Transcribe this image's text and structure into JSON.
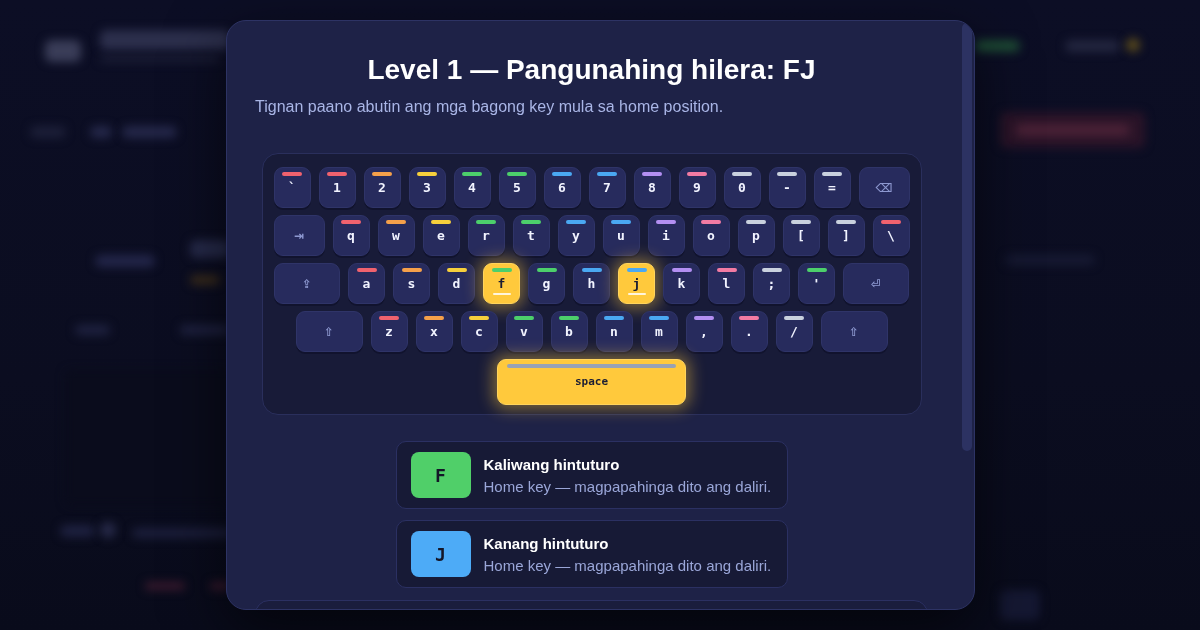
{
  "modal": {
    "title": "Level 1 — Pangunahing hilera: FJ",
    "subtitle": "Tignan paano abutin ang mga bagong key mula sa home position."
  },
  "keyboard": {
    "rows": [
      [
        {
          "label": "`",
          "kind": "char",
          "color": "#f0626e",
          "highlighted": false,
          "bump": false
        },
        {
          "label": "1",
          "kind": "char",
          "color": "#f0626e",
          "highlighted": false,
          "bump": false
        },
        {
          "label": "2",
          "kind": "char",
          "color": "#f5a04a",
          "highlighted": false,
          "bump": false
        },
        {
          "label": "3",
          "kind": "char",
          "color": "#f6cf3c",
          "highlighted": false,
          "bump": false
        },
        {
          "label": "4",
          "kind": "char",
          "color": "#4ccf6b",
          "highlighted": false,
          "bump": false
        },
        {
          "label": "5",
          "kind": "char",
          "color": "#4ccf6b",
          "highlighted": false,
          "bump": false
        },
        {
          "label": "6",
          "kind": "char",
          "color": "#4aa8f2",
          "highlighted": false,
          "bump": false
        },
        {
          "label": "7",
          "kind": "char",
          "color": "#4aa8f2",
          "highlighted": false,
          "bump": false
        },
        {
          "label": "8",
          "kind": "char",
          "color": "#b38ff2",
          "highlighted": false,
          "bump": false
        },
        {
          "label": "9",
          "kind": "char",
          "color": "#f27ba3",
          "highlighted": false,
          "bump": false
        },
        {
          "label": "0",
          "kind": "char",
          "color": "#c9d1de",
          "highlighted": false,
          "bump": false
        },
        {
          "label": "-",
          "kind": "char",
          "color": "#c9d1de",
          "highlighted": false,
          "bump": false
        },
        {
          "label": "=",
          "kind": "char",
          "color": "#c9d1de",
          "highlighted": false,
          "bump": false
        },
        {
          "label": "⌫",
          "kind": "backspace",
          "highlighted": false,
          "bump": false
        }
      ],
      [
        {
          "label": "⇥",
          "kind": "tab",
          "highlighted": false,
          "bump": false
        },
        {
          "label": "q",
          "kind": "char",
          "color": "#f0626e",
          "highlighted": false,
          "bump": false
        },
        {
          "label": "w",
          "kind": "char",
          "color": "#f5a04a",
          "highlighted": false,
          "bump": false
        },
        {
          "label": "e",
          "kind": "char",
          "color": "#f6cf3c",
          "highlighted": false,
          "bump": false
        },
        {
          "label": "r",
          "kind": "char",
          "color": "#4ccf6b",
          "highlighted": false,
          "bump": false
        },
        {
          "label": "t",
          "kind": "char",
          "color": "#4ccf6b",
          "highlighted": false,
          "bump": false
        },
        {
          "label": "y",
          "kind": "char",
          "color": "#4aa8f2",
          "highlighted": false,
          "bump": false
        },
        {
          "label": "u",
          "kind": "char",
          "color": "#4aa8f2",
          "highlighted": false,
          "bump": false
        },
        {
          "label": "i",
          "kind": "char",
          "color": "#b38ff2",
          "highlighted": false,
          "bump": false
        },
        {
          "label": "o",
          "kind": "char",
          "color": "#f27ba3",
          "highlighted": false,
          "bump": false
        },
        {
          "label": "p",
          "kind": "char",
          "color": "#c9d1de",
          "highlighted": false,
          "bump": false
        },
        {
          "label": "[",
          "kind": "char",
          "color": "#c9d1de",
          "highlighted": false,
          "bump": false
        },
        {
          "label": "]",
          "kind": "char",
          "color": "#c9d1de",
          "highlighted": false,
          "bump": false
        },
        {
          "label": "\\",
          "kind": "char",
          "color": "#f0626e",
          "highlighted": false,
          "bump": false
        }
      ],
      [
        {
          "label": "⇪",
          "kind": "caps",
          "highlighted": false,
          "bump": false
        },
        {
          "label": "a",
          "kind": "char",
          "color": "#f0626e",
          "highlighted": false,
          "bump": false
        },
        {
          "label": "s",
          "kind": "char",
          "color": "#f5a04a",
          "highlighted": false,
          "bump": false
        },
        {
          "label": "d",
          "kind": "char",
          "color": "#f6cf3c",
          "highlighted": false,
          "bump": false
        },
        {
          "label": "f",
          "kind": "char",
          "color": "#4ccf6b",
          "highlighted": true,
          "bump": true
        },
        {
          "label": "g",
          "kind": "char",
          "color": "#4ccf6b",
          "highlighted": false,
          "bump": false
        },
        {
          "label": "h",
          "kind": "char",
          "color": "#4aa8f2",
          "highlighted": false,
          "bump": false
        },
        {
          "label": "j",
          "kind": "char",
          "color": "#4aa8f2",
          "highlighted": true,
          "bump": true
        },
        {
          "label": "k",
          "kind": "char",
          "color": "#b38ff2",
          "highlighted": false,
          "bump": false
        },
        {
          "label": "l",
          "kind": "char",
          "color": "#f27ba3",
          "highlighted": false,
          "bump": false
        },
        {
          "label": ";",
          "kind": "char",
          "color": "#c9d1de",
          "highlighted": false,
          "bump": false
        },
        {
          "label": "'",
          "kind": "char",
          "color": "#4ccf6b",
          "highlighted": false,
          "bump": false
        },
        {
          "label": "⏎",
          "kind": "enter",
          "highlighted": false,
          "bump": false
        }
      ],
      [
        {
          "label": "⇧",
          "kind": "shift",
          "highlighted": false,
          "bump": false
        },
        {
          "label": "z",
          "kind": "char",
          "color": "#f0626e",
          "highlighted": false,
          "bump": false
        },
        {
          "label": "x",
          "kind": "char",
          "color": "#f5a04a",
          "highlighted": false,
          "bump": false
        },
        {
          "label": "c",
          "kind": "char",
          "color": "#f6cf3c",
          "highlighted": false,
          "bump": false
        },
        {
          "label": "v",
          "kind": "char",
          "color": "#4ccf6b",
          "highlighted": false,
          "bump": false
        },
        {
          "label": "b",
          "kind": "char",
          "color": "#4ccf6b",
          "highlighted": false,
          "bump": false
        },
        {
          "label": "n",
          "kind": "char",
          "color": "#4aa8f2",
          "highlighted": false,
          "bump": false
        },
        {
          "label": "m",
          "kind": "char",
          "color": "#4aa8f2",
          "highlighted": false,
          "bump": false
        },
        {
          "label": ",",
          "kind": "char",
          "color": "#b38ff2",
          "highlighted": false,
          "bump": false
        },
        {
          "label": ".",
          "kind": "char",
          "color": "#f27ba3",
          "highlighted": false,
          "bump": false
        },
        {
          "label": "/",
          "kind": "char",
          "color": "#c9d1de",
          "highlighted": false,
          "bump": false
        },
        {
          "label": "⇧",
          "kind": "shift",
          "highlighted": false,
          "bump": false
        }
      ],
      [
        {
          "label": "space",
          "kind": "space",
          "color": "#98a2b4",
          "highlighted": true,
          "bump": false
        }
      ]
    ]
  },
  "legend": [
    {
      "key": "F",
      "color": "#50cf69",
      "finger": "Kaliwang hintuturo",
      "note": "Home key — magpapahinga dito ang daliri."
    },
    {
      "key": "J",
      "color": "#4dabf7",
      "finger": "Kanang hintuturo",
      "note": "Home key — magpapahinga dito ang daliri."
    }
  ]
}
